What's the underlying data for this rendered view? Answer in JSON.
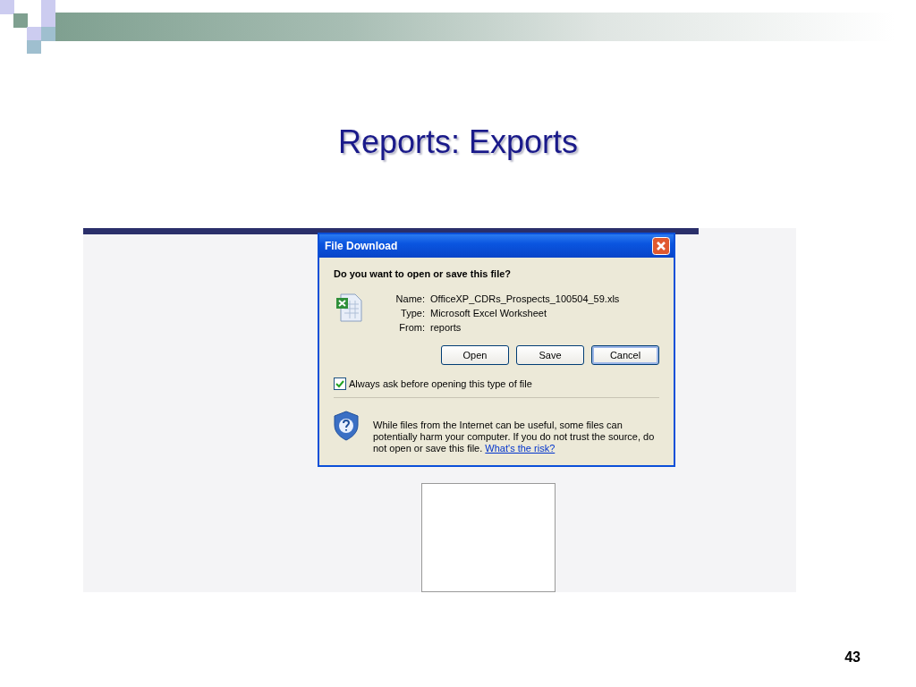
{
  "slide": {
    "title": "Reports:  Exports",
    "page_number": "43"
  },
  "dialog": {
    "title": "File Download",
    "question": "Do you want to open or save this file?",
    "fields": [
      {
        "label": "Name:",
        "value": "OfficeXP_CDRs_Prospects_100504_59.xls"
      },
      {
        "label": "Type:",
        "value": "Microsoft Excel Worksheet"
      },
      {
        "label": "From:",
        "value": "reports"
      }
    ],
    "buttons": [
      {
        "label": "Open",
        "focused": false
      },
      {
        "label": "Save",
        "focused": false
      },
      {
        "label": "Cancel",
        "focused": true
      }
    ],
    "checkbox": {
      "label": "Always ask before opening this type of file",
      "checked": true
    },
    "warning": {
      "text": "While files from the Internet can be useful, some files can potentially harm your computer. If you do not trust the source, do not open or save this file.",
      "link": "What's the risk?"
    }
  }
}
